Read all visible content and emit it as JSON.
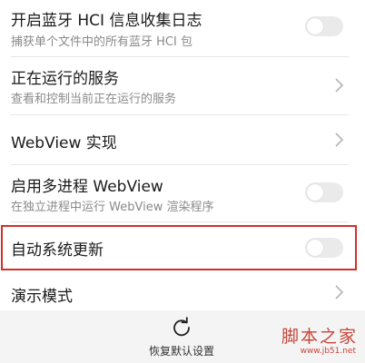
{
  "settings": [
    {
      "title": "开启蓝牙 HCI 信息收集日志",
      "subtitle": "捕获单个文件中的所有蓝牙 HCI 包",
      "control": "toggle",
      "enabled": false
    },
    {
      "title": "正在运行的服务",
      "subtitle": "查看和控制当前正在运行的服务",
      "control": "chevron"
    },
    {
      "title": "WebView 实现",
      "control": "chevron"
    },
    {
      "title": "启用多进程 WebView",
      "subtitle": "在独立进程中运行 WebView 渲染程序",
      "control": "toggle",
      "enabled": false
    },
    {
      "title": "自动系统更新",
      "control": "toggle",
      "enabled": false,
      "highlighted": true
    },
    {
      "title": "演示模式",
      "control": "chevron"
    }
  ],
  "bottom_bar": {
    "reset_label": "恢复默认设置",
    "reset_icon": "refresh-icon"
  },
  "watermark": {
    "main": "脚本之家",
    "sub": "www.jb51.net"
  },
  "colors": {
    "highlight_border": "#d0302b",
    "toggle_off": "#eaeaea",
    "watermark": "#c8463a"
  }
}
